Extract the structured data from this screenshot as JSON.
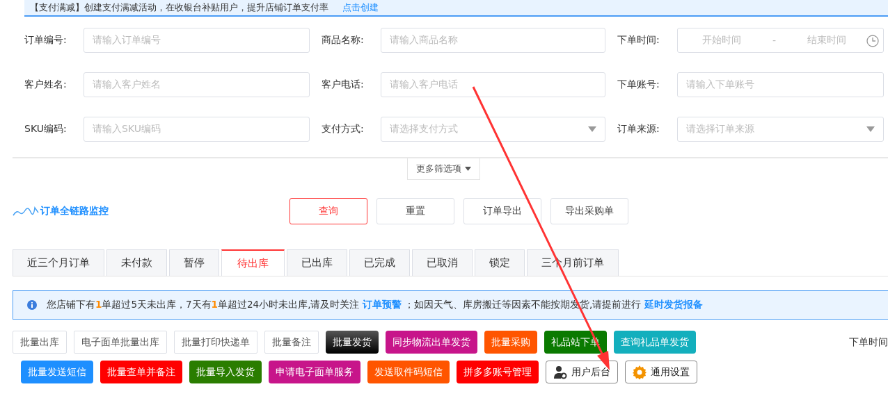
{
  "banner": {
    "text": "【支付满减】创建支付满减活动，在收银台补贴用户，提升店铺订单支付率",
    "link": "点击创建"
  },
  "filters": [
    {
      "label": "订单编号:",
      "kind": "text",
      "placeholder": "请输入订单编号"
    },
    {
      "label": "商品名称:",
      "kind": "text",
      "placeholder": "请输入商品名称"
    },
    {
      "label": "下单时间:",
      "kind": "range",
      "start": "开始时间",
      "separator": "-",
      "end": "结束时间"
    },
    {
      "label": "客户姓名:",
      "kind": "text",
      "placeholder": "请输入客户姓名"
    },
    {
      "label": "客户电话:",
      "kind": "text",
      "placeholder": "请输入客户电话"
    },
    {
      "label": "下单账号:",
      "kind": "text",
      "placeholder": "请输入下单账号"
    },
    {
      "label": "SKU编码:",
      "kind": "text",
      "placeholder": "请输入SKU编码"
    },
    {
      "label": "支付方式:",
      "kind": "select",
      "placeholder": "请选择支付方式"
    },
    {
      "label": "订单来源:",
      "kind": "select",
      "placeholder": "请选择订单来源"
    }
  ],
  "more_filters": "更多筛选项",
  "monitor_link": "订单全链路监控",
  "actions": [
    {
      "label": "查询",
      "kind": "primary"
    },
    {
      "label": "重置",
      "kind": "plain"
    },
    {
      "label": "订单导出",
      "kind": "plain"
    },
    {
      "label": "导出采购单",
      "kind": "plain"
    }
  ],
  "tabs": [
    {
      "label": "近三个月订单",
      "selected": false
    },
    {
      "label": "未付款",
      "selected": false
    },
    {
      "label": "暂停",
      "selected": false
    },
    {
      "label": "待出库",
      "selected": true
    },
    {
      "label": "已出库",
      "selected": false
    },
    {
      "label": "已完成",
      "selected": false
    },
    {
      "label": "已取消",
      "selected": false
    },
    {
      "label": "锁定",
      "selected": false
    },
    {
      "label": "三个月前订单",
      "selected": false
    }
  ],
  "notice": [
    {
      "kind": "text",
      "text": "您店铺下有"
    },
    {
      "kind": "highlight",
      "text": "1"
    },
    {
      "kind": "text",
      "text": "单超过5天未出库，7天有"
    },
    {
      "kind": "highlight",
      "text": "1"
    },
    {
      "kind": "text",
      "text": "单超过24小时未出库,请及时关注 "
    },
    {
      "kind": "link",
      "text": "订单预警"
    },
    {
      "kind": "text",
      "text": " ；如因天气、库房搬迁等因素不能按期发货,请提前进行 "
    },
    {
      "kind": "link",
      "text": "延时发货报备"
    }
  ],
  "button_rows": [
    [
      {
        "label": "批量出库",
        "kind": "outline"
      },
      {
        "label": "电子面单批量出库",
        "kind": "outline"
      },
      {
        "label": "批量打印快递单",
        "kind": "outline"
      },
      {
        "label": "批量备注",
        "kind": "outline"
      },
      {
        "label": "批量发货",
        "kind": "solid",
        "color": "#111111"
      },
      {
        "label": "同步物流出单发货",
        "kind": "solid",
        "color": "#c7158a"
      },
      {
        "label": "批量采购",
        "kind": "solid",
        "color": "#ff5500"
      },
      {
        "label": "礼品站下单",
        "kind": "solid",
        "color": "#0a7a00"
      },
      {
        "label": "查询礼品单发货",
        "kind": "solid",
        "color": "#13afbd"
      }
    ],
    [
      {
        "label": "批量发送短信",
        "kind": "solid",
        "color": "#1e8fff"
      },
      {
        "label": "批量查单并备注",
        "kind": "solid",
        "color": "#ff0000"
      },
      {
        "label": "批量导入发货",
        "kind": "solid",
        "color": "#2a7d00"
      },
      {
        "label": "申请电子面单服务",
        "kind": "solid",
        "color": "#c7158a"
      },
      {
        "label": "发送取件码短信",
        "kind": "solid",
        "color": "#ff5500"
      },
      {
        "label": "拼多多账号管理",
        "kind": "solid",
        "color": "#ff0000"
      },
      {
        "label": "用户后台",
        "kind": "user"
      },
      {
        "label": "通用设置",
        "kind": "settings"
      }
    ]
  ],
  "sort_label": "下单时间"
}
